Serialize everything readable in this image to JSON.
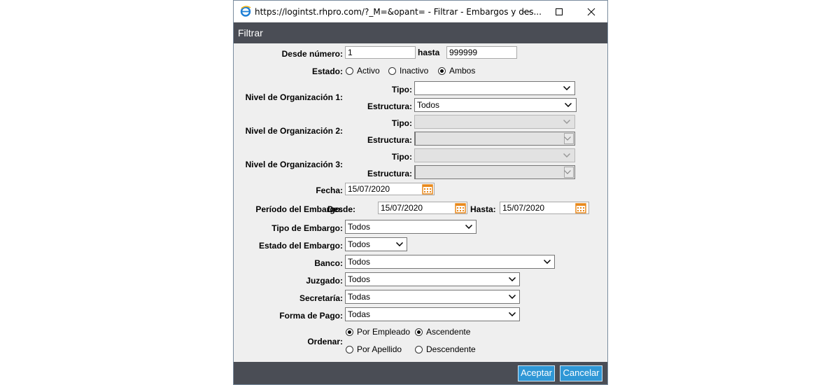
{
  "window": {
    "title": "https://logintst.rhpro.com/?_M=&opant= - Filtrar - Embargos y des..."
  },
  "dialog": {
    "header": "Filtrar",
    "desde_numero_label": "Desde número:",
    "desde_numero_value": "1",
    "hasta_label": "hasta",
    "hasta_value": "999999",
    "estado_label": "Estado:",
    "estado_options": [
      "Activo",
      "Inactivo",
      "Ambos"
    ],
    "estado_selected": "Ambos",
    "nivel1_label": "Nivel de Organización 1:",
    "nivel2_label": "Nivel de Organización 2:",
    "nivel3_label": "Nivel de Organización 3:",
    "tipo_label": "Tipo:",
    "estructura_label": "Estructura:",
    "nivel1_tipo_value": "",
    "nivel1_estructura_value": "Todos",
    "fecha_label": "Fecha:",
    "fecha_value": "15/07/2020",
    "periodo_label": "Período del Embargo:",
    "periodo_desde_label": "Desde:",
    "periodo_desde_value": "15/07/2020",
    "periodo_hasta_label": "Hasta:",
    "periodo_hasta_value": "15/07/2020",
    "tipo_embargo_label": "Tipo de Embargo:",
    "tipo_embargo_value": "Todos",
    "estado_embargo_label": "Estado del Embargo:",
    "estado_embargo_value": "Todos",
    "banco_label": "Banco:",
    "banco_value": "Todos",
    "juzgado_label": "Juzgado:",
    "juzgado_value": "Todos",
    "secretaria_label": "Secretaría:",
    "secretaria_value": "Todas",
    "forma_pago_label": "Forma de Pago:",
    "forma_pago_value": "Todas",
    "ordenar_label": "Ordenar:",
    "ordenar_options": [
      "Por Empleado",
      "Por Apellido"
    ],
    "ordenar_selected": "Por Empleado",
    "direccion_options": [
      "Ascendente",
      "Descendente"
    ],
    "direccion_selected": "Ascendente"
  },
  "footer": {
    "aceptar": "Aceptar",
    "cancelar": "Cancelar"
  },
  "colors": {
    "header_bg": "#4a4d55",
    "button_bg": "#2f97d6",
    "calendar_icon": "#e8891c"
  }
}
